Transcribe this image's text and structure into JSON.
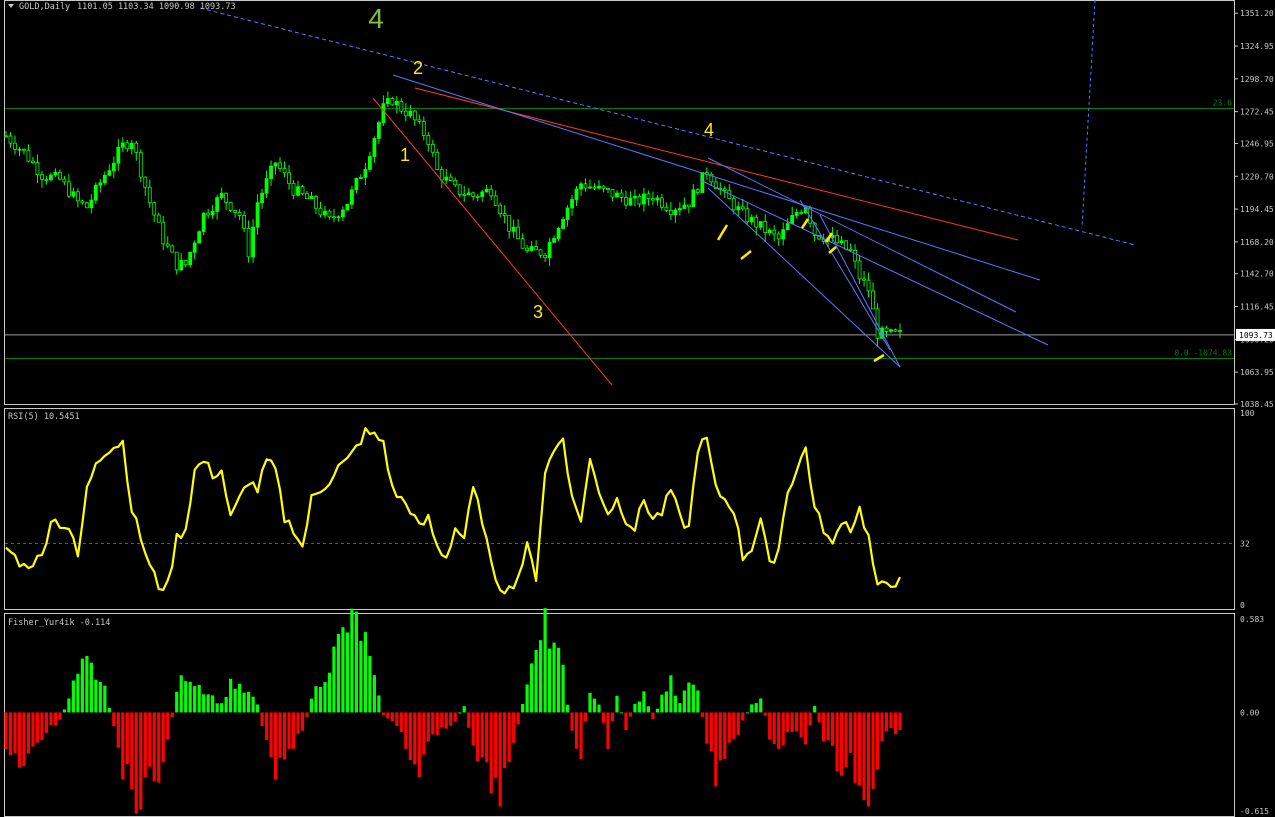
{
  "colors": {
    "background": "#000000",
    "frame": "#c8c8c8",
    "candle": "#00ff00",
    "rsi": "#ffff00",
    "fisher_pos": "#00ff00",
    "fisher_neg": "#ff0000",
    "fib": "#008000",
    "trend_blue": "#5a78ff",
    "trend_red": "#ff3b1f",
    "wave_yellow": "#ffea00",
    "wave_big": "#7fbf3f",
    "text": "#c8c8c8"
  },
  "main": {
    "title": "GOLD,Daily",
    "ohlc": "1101.05 1103.34 1090.98 1093.73",
    "price_ticks": [
      "1351.20",
      "1324.95",
      "1298.70",
      "1272.45",
      "1246.95",
      "1220.70",
      "1194.45",
      "1168.20",
      "1142.70",
      "1116.45",
      "1090.20",
      "1063.95",
      "1038.45"
    ],
    "current_price": "1093.73",
    "fib_labels": [
      {
        "text": "23.6",
        "price": 1275.0
      },
      {
        "text": "0.0 -1074.83",
        "price": 1074.83
      }
    ],
    "wave_labels": [
      {
        "text": "4",
        "big": true,
        "price": 1356,
        "bar": 0.42
      },
      {
        "text": "2",
        "big": false,
        "price": 1299,
        "bar": 0.465
      },
      {
        "text": "1",
        "big": false,
        "price": 1237,
        "bar": 0.455
      },
      {
        "text": "3",
        "big": false,
        "price": 1085,
        "bar": 0.6
      },
      {
        "text": "4",
        "big": false,
        "price": 1248,
        "bar": 0.79
      }
    ]
  },
  "chart_data": [
    {
      "type": "candlestick",
      "title": "GOLD,Daily",
      "ylim": [
        1038.45,
        1361.0
      ],
      "bars": 200,
      "close_path": [
        [
          0,
          1253
        ],
        [
          4,
          1240
        ],
        [
          8,
          1222
        ],
        [
          12,
          1218
        ],
        [
          16,
          1200
        ],
        [
          18,
          1196
        ],
        [
          22,
          1222
        ],
        [
          26,
          1245
        ],
        [
          28,
          1250
        ],
        [
          32,
          1200
        ],
        [
          35,
          1170
        ],
        [
          38,
          1150
        ],
        [
          40,
          1150
        ],
        [
          44,
          1190
        ],
        [
          48,
          1205
        ],
        [
          52,
          1190
        ],
        [
          54,
          1160
        ],
        [
          56,
          1200
        ],
        [
          60,
          1232
        ],
        [
          64,
          1210
        ],
        [
          68,
          1200
        ],
        [
          72,
          1185
        ],
        [
          76,
          1200
        ],
        [
          80,
          1230
        ],
        [
          84,
          1275
        ],
        [
          86,
          1282
        ],
        [
          88,
          1275
        ],
        [
          90,
          1270
        ],
        [
          92,
          1260
        ],
        [
          94,
          1250
        ],
        [
          96,
          1225
        ],
        [
          100,
          1210
        ],
        [
          104,
          1205
        ],
        [
          108,
          1210
        ],
        [
          112,
          1180
        ],
        [
          116,
          1160
        ],
        [
          120,
          1160
        ],
        [
          124,
          1190
        ],
        [
          128,
          1215
        ],
        [
          132,
          1210
        ],
        [
          136,
          1205
        ],
        [
          140,
          1200
        ],
        [
          144,
          1205
        ],
        [
          148,
          1195
        ],
        [
          152,
          1200
        ],
        [
          156,
          1225
        ],
        [
          160,
          1205
        ],
        [
          164,
          1190
        ],
        [
          168,
          1180
        ],
        [
          172,
          1170
        ],
        [
          176,
          1192
        ],
        [
          178,
          1198
        ],
        [
          180,
          1175
        ],
        [
          184,
          1170
        ],
        [
          186,
          1165
        ],
        [
          188,
          1160
        ],
        [
          190,
          1140
        ],
        [
          192,
          1130
        ],
        [
          194,
          1095
        ],
        [
          196,
          1093.73
        ]
      ]
    },
    {
      "type": "line",
      "title": "RSI(5) 10.5451",
      "ylim": [
        0,
        100
      ],
      "levels": [
        "100",
        "32",
        "0"
      ],
      "level_values": [
        100,
        32,
        0
      ],
      "series": [
        {
          "name": "RSI(5)",
          "values": [
            [
              0,
              30
            ],
            [
              4,
              20
            ],
            [
              8,
              25
            ],
            [
              10,
              45
            ],
            [
              14,
              40
            ],
            [
              16,
              25
            ],
            [
              18,
              60
            ],
            [
              20,
              75
            ],
            [
              22,
              80
            ],
            [
              26,
              85
            ],
            [
              28,
              50
            ],
            [
              30,
              35
            ],
            [
              32,
              20
            ],
            [
              34,
              10
            ],
            [
              36,
              10
            ],
            [
              38,
              35
            ],
            [
              40,
              40
            ],
            [
              42,
              70
            ],
            [
              44,
              75
            ],
            [
              46,
              68
            ],
            [
              48,
              70
            ],
            [
              50,
              45
            ],
            [
              52,
              55
            ],
            [
              54,
              65
            ],
            [
              56,
              60
            ],
            [
              58,
              75
            ],
            [
              60,
              70
            ],
            [
              62,
              45
            ],
            [
              64,
              40
            ],
            [
              66,
              30
            ],
            [
              68,
              55
            ],
            [
              70,
              60
            ],
            [
              72,
              65
            ],
            [
              74,
              72
            ],
            [
              76,
              75
            ],
            [
              78,
              82
            ],
            [
              80,
              90
            ],
            [
              82,
              88
            ],
            [
              84,
              85
            ],
            [
              86,
              60
            ],
            [
              88,
              55
            ],
            [
              90,
              50
            ],
            [
              92,
              40
            ],
            [
              94,
              45
            ],
            [
              96,
              30
            ],
            [
              98,
              25
            ],
            [
              100,
              40
            ],
            [
              102,
              35
            ],
            [
              104,
              60
            ],
            [
              106,
              45
            ],
            [
              108,
              20
            ],
            [
              110,
              10
            ],
            [
              112,
              8
            ],
            [
              114,
              15
            ],
            [
              116,
              30
            ],
            [
              118,
              15
            ],
            [
              120,
              70
            ],
            [
              122,
              80
            ],
            [
              124,
              88
            ],
            [
              126,
              55
            ],
            [
              128,
              45
            ],
            [
              130,
              75
            ],
            [
              132,
              60
            ],
            [
              134,
              48
            ],
            [
              136,
              55
            ],
            [
              138,
              45
            ],
            [
              140,
              40
            ],
            [
              142,
              55
            ],
            [
              144,
              45
            ],
            [
              146,
              48
            ],
            [
              148,
              60
            ],
            [
              150,
              45
            ],
            [
              152,
              40
            ],
            [
              154,
              82
            ],
            [
              156,
              86
            ],
            [
              158,
              60
            ],
            [
              160,
              55
            ],
            [
              162,
              50
            ],
            [
              164,
              25
            ],
            [
              166,
              30
            ],
            [
              168,
              45
            ],
            [
              170,
              20
            ],
            [
              172,
              30
            ],
            [
              174,
              60
            ],
            [
              176,
              70
            ],
            [
              178,
              82
            ],
            [
              180,
              50
            ],
            [
              182,
              40
            ],
            [
              184,
              30
            ],
            [
              186,
              45
            ],
            [
              188,
              40
            ],
            [
              190,
              50
            ],
            [
              192,
              35
            ],
            [
              194,
              8
            ],
            [
              196,
              12
            ]
          ]
        }
      ]
    },
    {
      "type": "bar",
      "title": "Fisher_Yur4ik -0.114",
      "ylim": [
        -0.615,
        0.583
      ],
      "levels": [
        "0.583",
        "0.00",
        "-0.615"
      ],
      "level_values": [
        0.583,
        0,
        -0.615
      ],
      "series": [
        {
          "name": "Fisher_Yur4ik",
          "values": [
            [
              0,
              -0.2
            ],
            [
              4,
              -0.35
            ],
            [
              8,
              -0.15
            ],
            [
              12,
              -0.05
            ],
            [
              14,
              0.1
            ],
            [
              16,
              0.25
            ],
            [
              18,
              0.35
            ],
            [
              20,
              0.18
            ],
            [
              22,
              0.15
            ],
            [
              24,
              -0.1
            ],
            [
              26,
              -0.35
            ],
            [
              28,
              -0.5
            ],
            [
              30,
              -0.58
            ],
            [
              32,
              -0.45
            ],
            [
              34,
              -0.4
            ],
            [
              36,
              -0.2
            ],
            [
              38,
              0.15
            ],
            [
              40,
              0.25
            ],
            [
              42,
              0.2
            ],
            [
              44,
              0.15
            ],
            [
              46,
              0.1
            ],
            [
              48,
              0.05
            ],
            [
              50,
              0.2
            ],
            [
              52,
              0.15
            ],
            [
              54,
              0.12
            ],
            [
              56,
              0.05
            ],
            [
              58,
              -0.2
            ],
            [
              60,
              -0.35
            ],
            [
              62,
              -0.25
            ],
            [
              64,
              -0.2
            ],
            [
              66,
              -0.15
            ],
            [
              68,
              0.1
            ],
            [
              70,
              0.2
            ],
            [
              72,
              0.3
            ],
            [
              74,
              0.45
            ],
            [
              76,
              0.55
            ],
            [
              78,
              0.58
            ],
            [
              80,
              0.45
            ],
            [
              82,
              0.2
            ],
            [
              84,
              -0.02
            ],
            [
              86,
              -0.05
            ],
            [
              88,
              -0.15
            ],
            [
              90,
              -0.3
            ],
            [
              92,
              -0.35
            ],
            [
              94,
              -0.2
            ],
            [
              96,
              -0.15
            ],
            [
              98,
              -0.1
            ],
            [
              100,
              -0.05
            ],
            [
              102,
              0.05
            ],
            [
              104,
              -0.25
            ],
            [
              106,
              -0.35
            ],
            [
              108,
              -0.45
            ],
            [
              110,
              -0.5
            ],
            [
              112,
              -0.35
            ],
            [
              114,
              -0.1
            ],
            [
              116,
              0.2
            ],
            [
              118,
              0.35
            ],
            [
              120,
              0.55
            ],
            [
              122,
              0.45
            ],
            [
              124,
              0.25
            ],
            [
              126,
              -0.15
            ],
            [
              128,
              -0.25
            ],
            [
              130,
              0.15
            ],
            [
              132,
              0.05
            ],
            [
              134,
              -0.2
            ],
            [
              136,
              0.1
            ],
            [
              138,
              -0.1
            ],
            [
              140,
              0.05
            ],
            [
              142,
              0.12
            ],
            [
              144,
              -0.05
            ],
            [
              146,
              0.1
            ],
            [
              148,
              0.2
            ],
            [
              150,
              0.05
            ],
            [
              152,
              0.2
            ],
            [
              154,
              0.15
            ],
            [
              156,
              -0.2
            ],
            [
              158,
              -0.4
            ],
            [
              160,
              -0.3
            ],
            [
              162,
              -0.2
            ],
            [
              164,
              -0.05
            ],
            [
              166,
              0.05
            ],
            [
              168,
              0.1
            ],
            [
              170,
              -0.15
            ],
            [
              172,
              -0.3
            ],
            [
              174,
              -0.15
            ],
            [
              176,
              -0.1
            ],
            [
              178,
              -0.25
            ],
            [
              180,
              0.05
            ],
            [
              182,
              -0.2
            ],
            [
              184,
              -0.25
            ],
            [
              186,
              -0.4
            ],
            [
              188,
              -0.3
            ],
            [
              190,
              -0.45
            ],
            [
              192,
              -0.55
            ],
            [
              194,
              -0.3
            ],
            [
              196,
              -0.114
            ]
          ]
        }
      ]
    }
  ]
}
